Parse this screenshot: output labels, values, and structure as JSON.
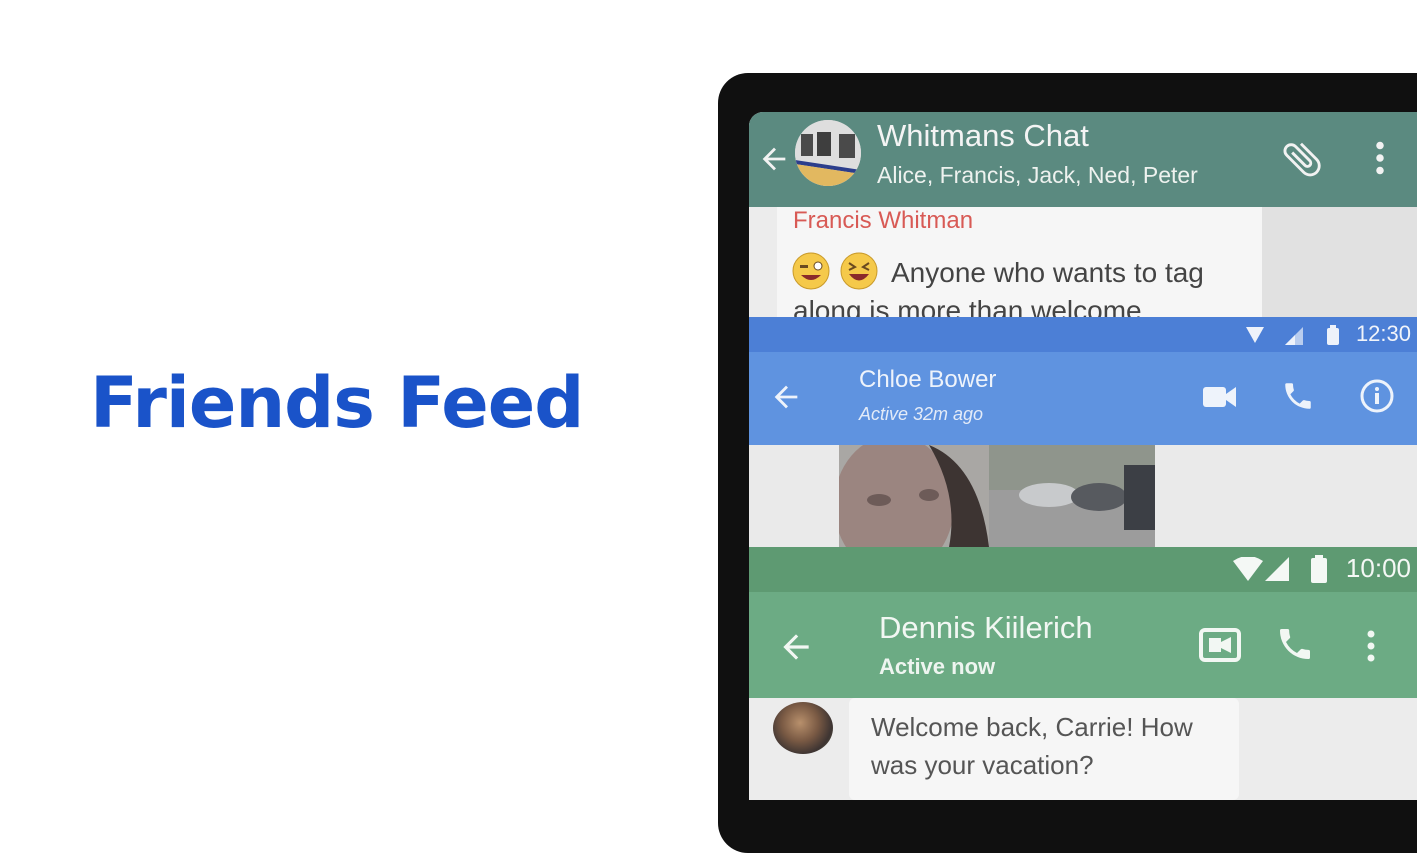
{
  "hero": {
    "title": "Friends Feed",
    "color": "#1a53c9"
  },
  "screens": {
    "group_chat": {
      "title": "Whitmans Chat",
      "members": "Alice, Francis, Jack, Ned, Peter",
      "header_color": "#5b8a80",
      "message": {
        "sender": "Francis Whitman",
        "sender_color": "#d85a55",
        "emojis": [
          "winking-face-emoji",
          "laughing-face-emoji"
        ],
        "text_line1": "Anyone who wants to tag",
        "text_line2": "along is more than welcome"
      },
      "icons": [
        "back-arrow-icon",
        "group-avatar",
        "paperclip-icon",
        "more-vert-icon"
      ]
    },
    "direct_chat_1": {
      "status_time": "12:30",
      "title": "Chloe Bower",
      "subtitle": "Active 32m ago",
      "header_color": "#5f93e0",
      "icons": [
        "back-arrow-icon",
        "video-call-icon",
        "phone-icon",
        "info-icon"
      ],
      "content": "photo-message"
    },
    "direct_chat_2": {
      "status_time": "10:00",
      "title": "Dennis Kiilerich",
      "subtitle": "Active now",
      "header_color": "#6cab84",
      "message": "Welcome back, Carrie! How was your vacation?",
      "icons": [
        "back-arrow-icon",
        "video-call-icon",
        "phone-icon",
        "more-vert-icon"
      ]
    }
  }
}
